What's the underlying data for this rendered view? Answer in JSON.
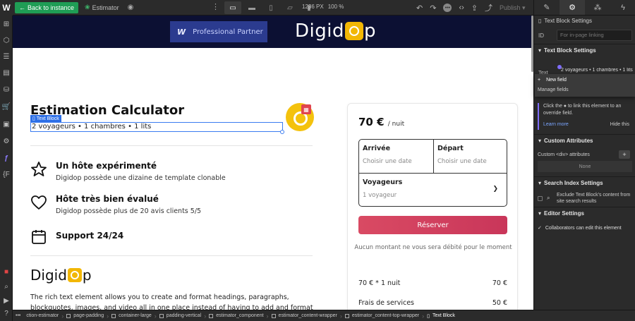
{
  "topbar": {
    "logo": "W",
    "back_label": "Back to instance",
    "page_name": "Estimator",
    "dimensions_px": "1236 PX",
    "zoom": "100 %",
    "publish_label": "Publish"
  },
  "page": {
    "header": {
      "partner_logo_letter": "W",
      "partner_label": "Professional Partner",
      "brand_left": "Digid",
      "brand_right": "p"
    },
    "title": "Estimation Calculator",
    "element_tag": "Text Block",
    "text_block": "2 voyageurs • 1 chambres • 1 lits",
    "features": [
      {
        "title": "Un hôte expérimenté",
        "desc": "Digidop possède une dizaine de template clonable",
        "icon": "star-icon"
      },
      {
        "title": "Hôte très bien évalué",
        "desc": "Digidop possède plus de 20 avis clients 5/5",
        "icon": "heart-icon"
      },
      {
        "title": "Support 24/24",
        "desc": "",
        "icon": "calendar-icon"
      }
    ],
    "brand_body_left": "Digid",
    "brand_body_right": "p",
    "rich_text": "The rich text element allows you to create and format headings, paragraphs, blockquotes, images, and video all in one place instead of having to add and format them individually. Just"
  },
  "booking": {
    "price": "70 €",
    "per_night": "/ nuit",
    "arrival_label": "Arrivée",
    "arrival_placeholder": "Choisir une date",
    "departure_label": "Départ",
    "departure_placeholder": "Choisir une date",
    "guests_label": "Voyageurs",
    "guests_value": "1 voyageur",
    "reserve_label": "Réserver",
    "notice": "Aucun montant ne vous sera débité pour le moment",
    "line_items": [
      {
        "label": "70 € * 1 nuit",
        "value": "70 €"
      },
      {
        "label": "Frais de services",
        "value": "50 €"
      }
    ]
  },
  "panel": {
    "header": "Text Block Settings",
    "id_label": "ID",
    "id_placeholder": "For in-page linking",
    "section_settings": "Text Block Settings",
    "text_label": "Text",
    "text_value": "2 voyageurs • 1 chambres • 1 lits",
    "dropdown_new": "New field",
    "dropdown_manage": "Manage fields",
    "info_text": "Click the ● to link this element to an override field.",
    "learn_more": "Learn more",
    "hide_this": "Hide this",
    "section_custom": "Custom Attributes",
    "custom_div_label": "Custom <div> attributes",
    "none_label": "None",
    "section_search": "Search Index Settings",
    "exclude_text": "Exclude Text Block's content from site search results",
    "section_editor": "Editor Settings",
    "collab_text": "Collaborators can edit this element"
  },
  "breadcrumb": [
    "ction-estimator",
    "page-padding",
    "container-large",
    "padding-vertical",
    "estimator_component",
    "estimator_content-wrapper",
    "estimator_content-top-wrapper",
    "Text Block"
  ],
  "colors": {
    "accent": "#7f6dff",
    "reserve": "#d94a63",
    "brand_yellow": "#f4c20d",
    "back_green": "#1f9d55",
    "header_navy": "#0c1033"
  }
}
